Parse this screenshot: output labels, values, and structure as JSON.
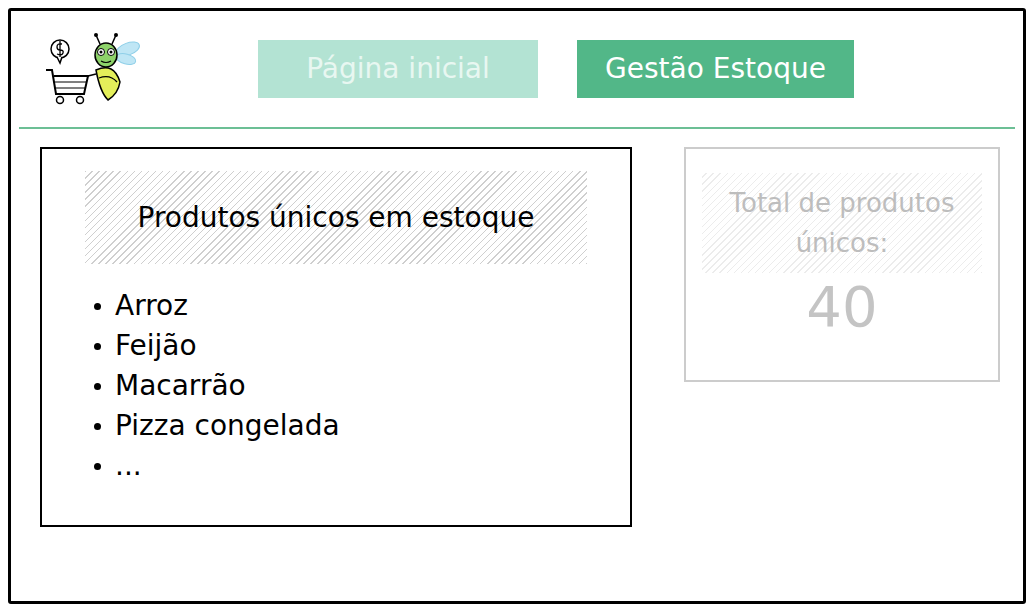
{
  "tabs": [
    {
      "label": "Página inicial",
      "selected": false
    },
    {
      "label": "Gestão Estoque",
      "selected": true
    }
  ],
  "stock_list": {
    "title": "Produtos únicos em estoque",
    "items": [
      "Arroz",
      "Feijão",
      "Macarrão",
      "Pizza congelada",
      "..."
    ]
  },
  "total_card": {
    "title": "Total de produtos únicos:",
    "value": "40",
    "disabled": true
  }
}
